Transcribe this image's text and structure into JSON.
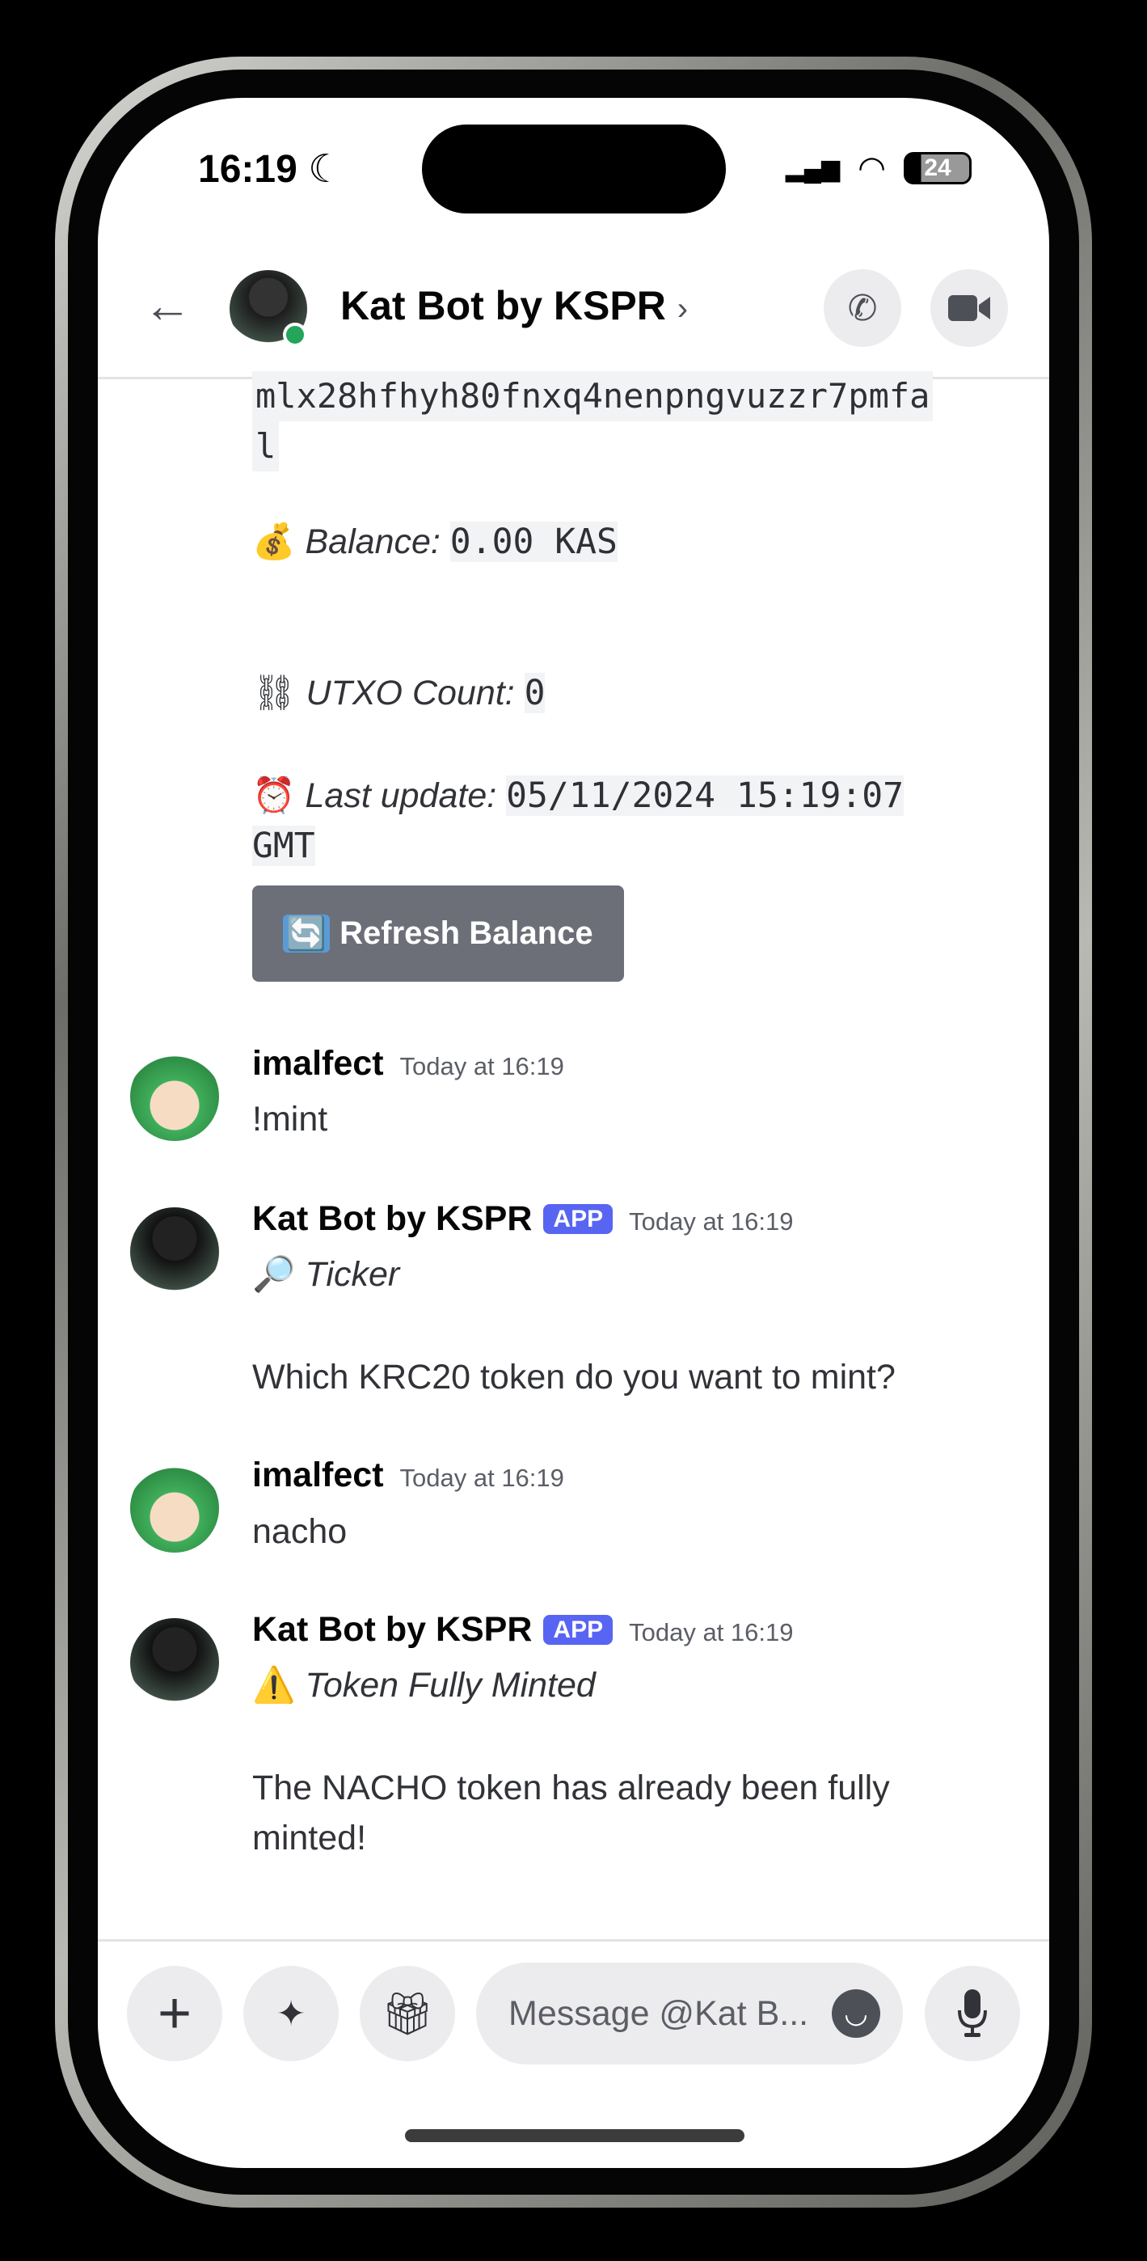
{
  "status": {
    "time": "16:19",
    "battery": "24"
  },
  "header": {
    "title": "Kat Bot by KSPR",
    "chevron": "›"
  },
  "wallet": {
    "address_line1": "mlx28hfhyh80fnxq4nenpngvuzzr7pmfa",
    "address_line2": "l",
    "balance_label": "Balance:",
    "balance_value": "0.00 KAS",
    "utxo_label": "UTXO Count:",
    "utxo_value": "0",
    "update_label": "Last update:",
    "update_value": "05/11/2024 15:19:07",
    "update_value2": "GMT",
    "refresh_label": "Refresh Balance"
  },
  "messages": [
    {
      "author": "imalfect",
      "time": "Today at 16:19",
      "text": "!mint"
    },
    {
      "author": "Kat Bot by KSPR",
      "badge": "APP",
      "time": "Today at 16:19",
      "title": "Ticker",
      "text": "Which KRC20 token do you want to mint?"
    },
    {
      "author": "imalfect",
      "time": "Today at 16:19",
      "text": "nacho"
    },
    {
      "author": "Kat Bot by KSPR",
      "badge": "APP",
      "time": "Today at 16:19",
      "title": "Token Fully Minted",
      "text": "The NACHO token has already been fully minted!"
    }
  ],
  "composer": {
    "placeholder": "Message @Kat B..."
  }
}
